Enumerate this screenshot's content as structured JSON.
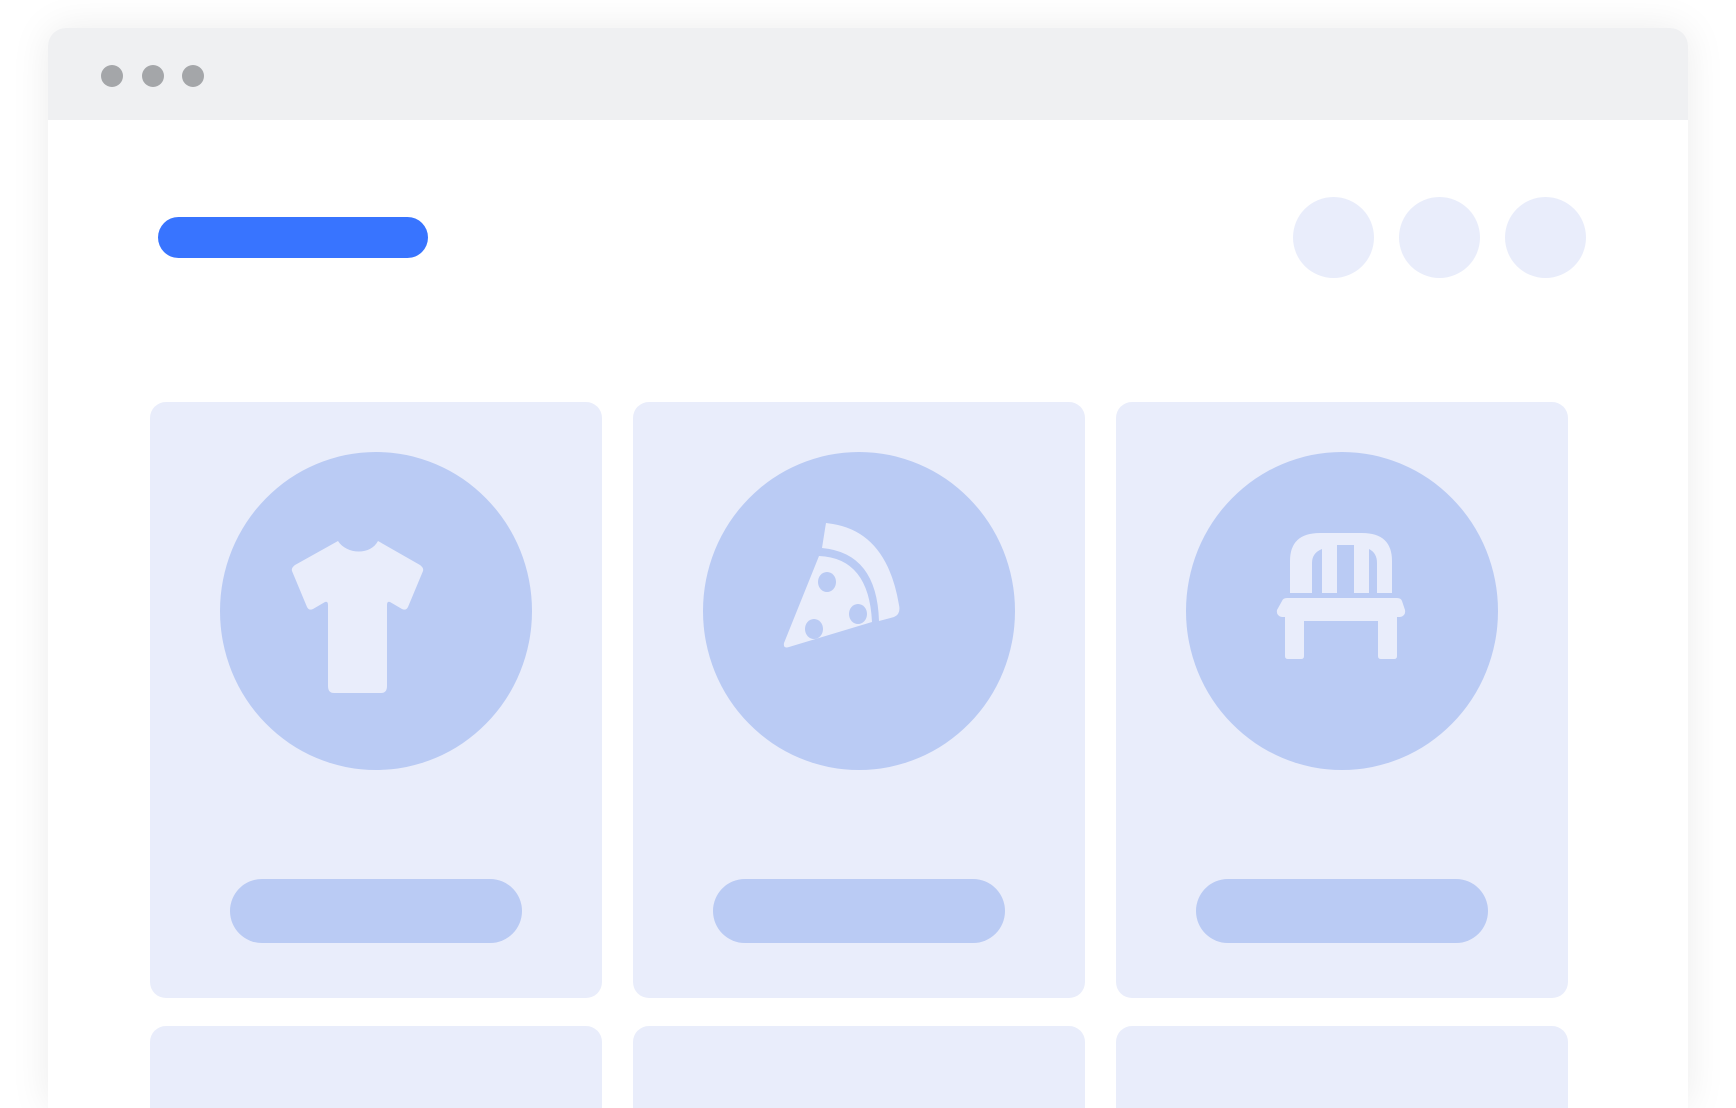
{
  "window": {
    "controls": [
      "window-dot",
      "window-dot",
      "window-dot"
    ],
    "control_color": "#a4a6a9",
    "titlebar_color": "#eff0f2"
  },
  "header": {
    "logo_color": "#3874ff",
    "nav_items": [
      "nav-circle",
      "nav-circle",
      "nav-circle"
    ]
  },
  "colors": {
    "accent": "#3874ff",
    "card_background": "#e9edfb",
    "icon_background": "#bacbf4",
    "icon_foreground": "#e9edfb"
  },
  "categories": [
    {
      "icon": "tshirt-icon",
      "button_label": ""
    },
    {
      "icon": "pizza-slice-icon",
      "button_label": ""
    },
    {
      "icon": "bench-icon",
      "button_label": ""
    }
  ],
  "second_row_cards": 3
}
